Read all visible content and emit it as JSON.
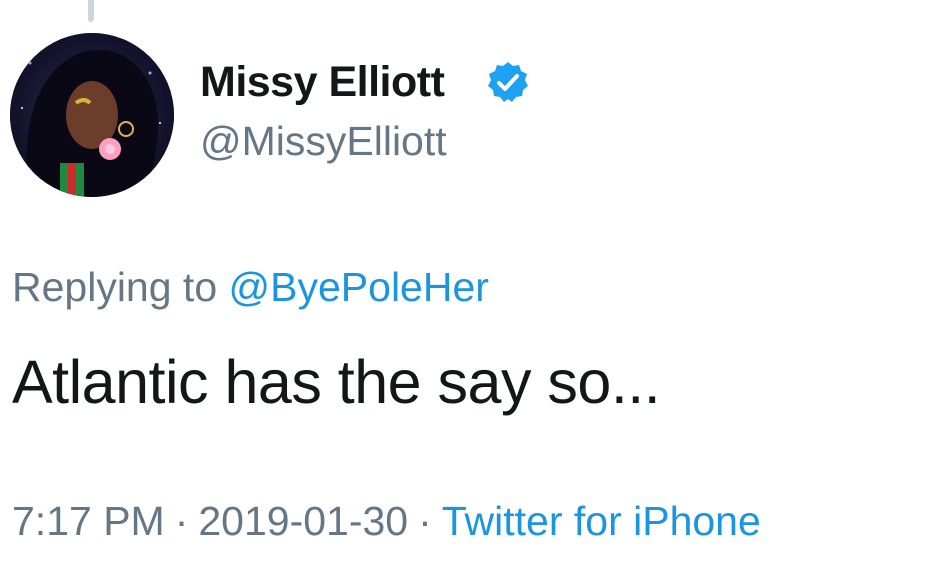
{
  "tweet": {
    "author": {
      "display_name": "Missy Elliott",
      "handle": "@MissyElliott",
      "verified": true,
      "avatar_icon": "avatar-illustration"
    },
    "reply": {
      "prefix": "Replying to",
      "mention": "@ByePoleHer"
    },
    "text": "Atlantic has the say so...",
    "meta": {
      "time": "7:17 PM",
      "separator": "·",
      "date": "2019-01-30",
      "source": "Twitter for iPhone"
    }
  },
  "colors": {
    "text_primary": "#14171a",
    "text_secondary": "#657786",
    "link": "#1b95e0",
    "verified_badge": "#1da1f2",
    "thread_line": "#ccd6dd"
  }
}
